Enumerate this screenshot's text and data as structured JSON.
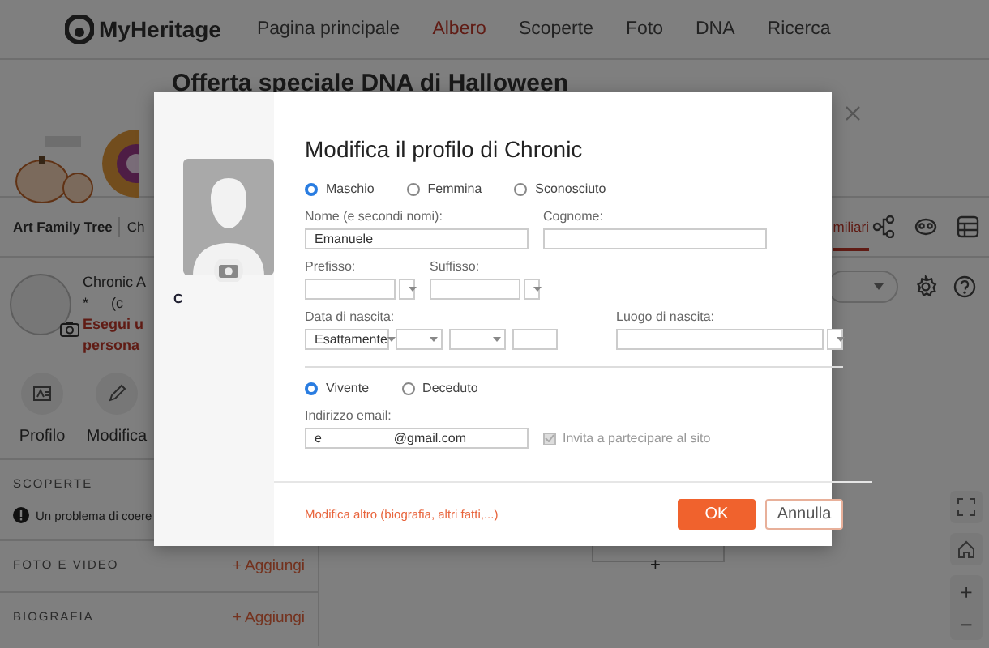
{
  "header": {
    "logo": "MyHeritage",
    "nav": [
      {
        "label": "Pagina principale",
        "selected": false
      },
      {
        "label": "Albero",
        "selected": true
      },
      {
        "label": "Scoperte",
        "selected": false
      },
      {
        "label": "Foto",
        "selected": false
      },
      {
        "label": "DNA",
        "selected": false
      },
      {
        "label": "Ricerca",
        "selected": false
      }
    ]
  },
  "banner": {
    "title": "Offerta speciale DNA di Halloween"
  },
  "tree_bar": {
    "tree_name": "Art Family Tree",
    "breadcrumb": "Ch",
    "view_tab": "miliari"
  },
  "profile": {
    "name": "Chronic A",
    "line_2": "*",
    "line_3": "(c",
    "warning_lines": [
      "Esegui u",
      "persona"
    ],
    "actions": [
      {
        "label": "Profilo"
      },
      {
        "label": "Modifica"
      }
    ]
  },
  "sections": [
    {
      "title": "SCOPERTE",
      "item": "Un problema di coere"
    },
    {
      "title": "FOTO E VIDEO",
      "action": "+ Aggiungi"
    },
    {
      "title": "BIOGRAFIA",
      "action": "+ Aggiungi"
    }
  ],
  "canvas": {
    "zoom_in": "+",
    "zoom_out": "−",
    "node_add": "+"
  },
  "modal": {
    "title": "Modifica il profilo di Chronic",
    "photo_caption": "C",
    "gender": [
      {
        "label": "Maschio",
        "selected": true
      },
      {
        "label": "Femmina",
        "selected": false
      },
      {
        "label": "Sconosciuto",
        "selected": false
      }
    ],
    "first_name": {
      "label": "Nome (e secondi nomi):",
      "value": "Emanuele"
    },
    "surname": {
      "label": "Cognome:"
    },
    "prefix": {
      "label": "Prefisso:"
    },
    "suffix": {
      "label": "Suffisso:"
    },
    "birth_date": {
      "label": "Data di nascita:",
      "qualifier": "Esattamente"
    },
    "birth_place": {
      "label": "Luogo di nascita:"
    },
    "status": [
      {
        "label": "Vivente",
        "selected": true
      },
      {
        "label": "Deceduto",
        "selected": false
      }
    ],
    "email": {
      "label": "Indirizzo email:",
      "value": "e                    @gmail.com"
    },
    "invite": {
      "label": "Invita a partecipare al sito",
      "checked": true,
      "disabled": true
    },
    "more_link": "Modifica altro (biografia, altri fatti,...)",
    "buttons": [
      {
        "label": "OK",
        "kind": "primary"
      },
      {
        "label": "Annulla",
        "kind": "secondary"
      }
    ]
  }
}
